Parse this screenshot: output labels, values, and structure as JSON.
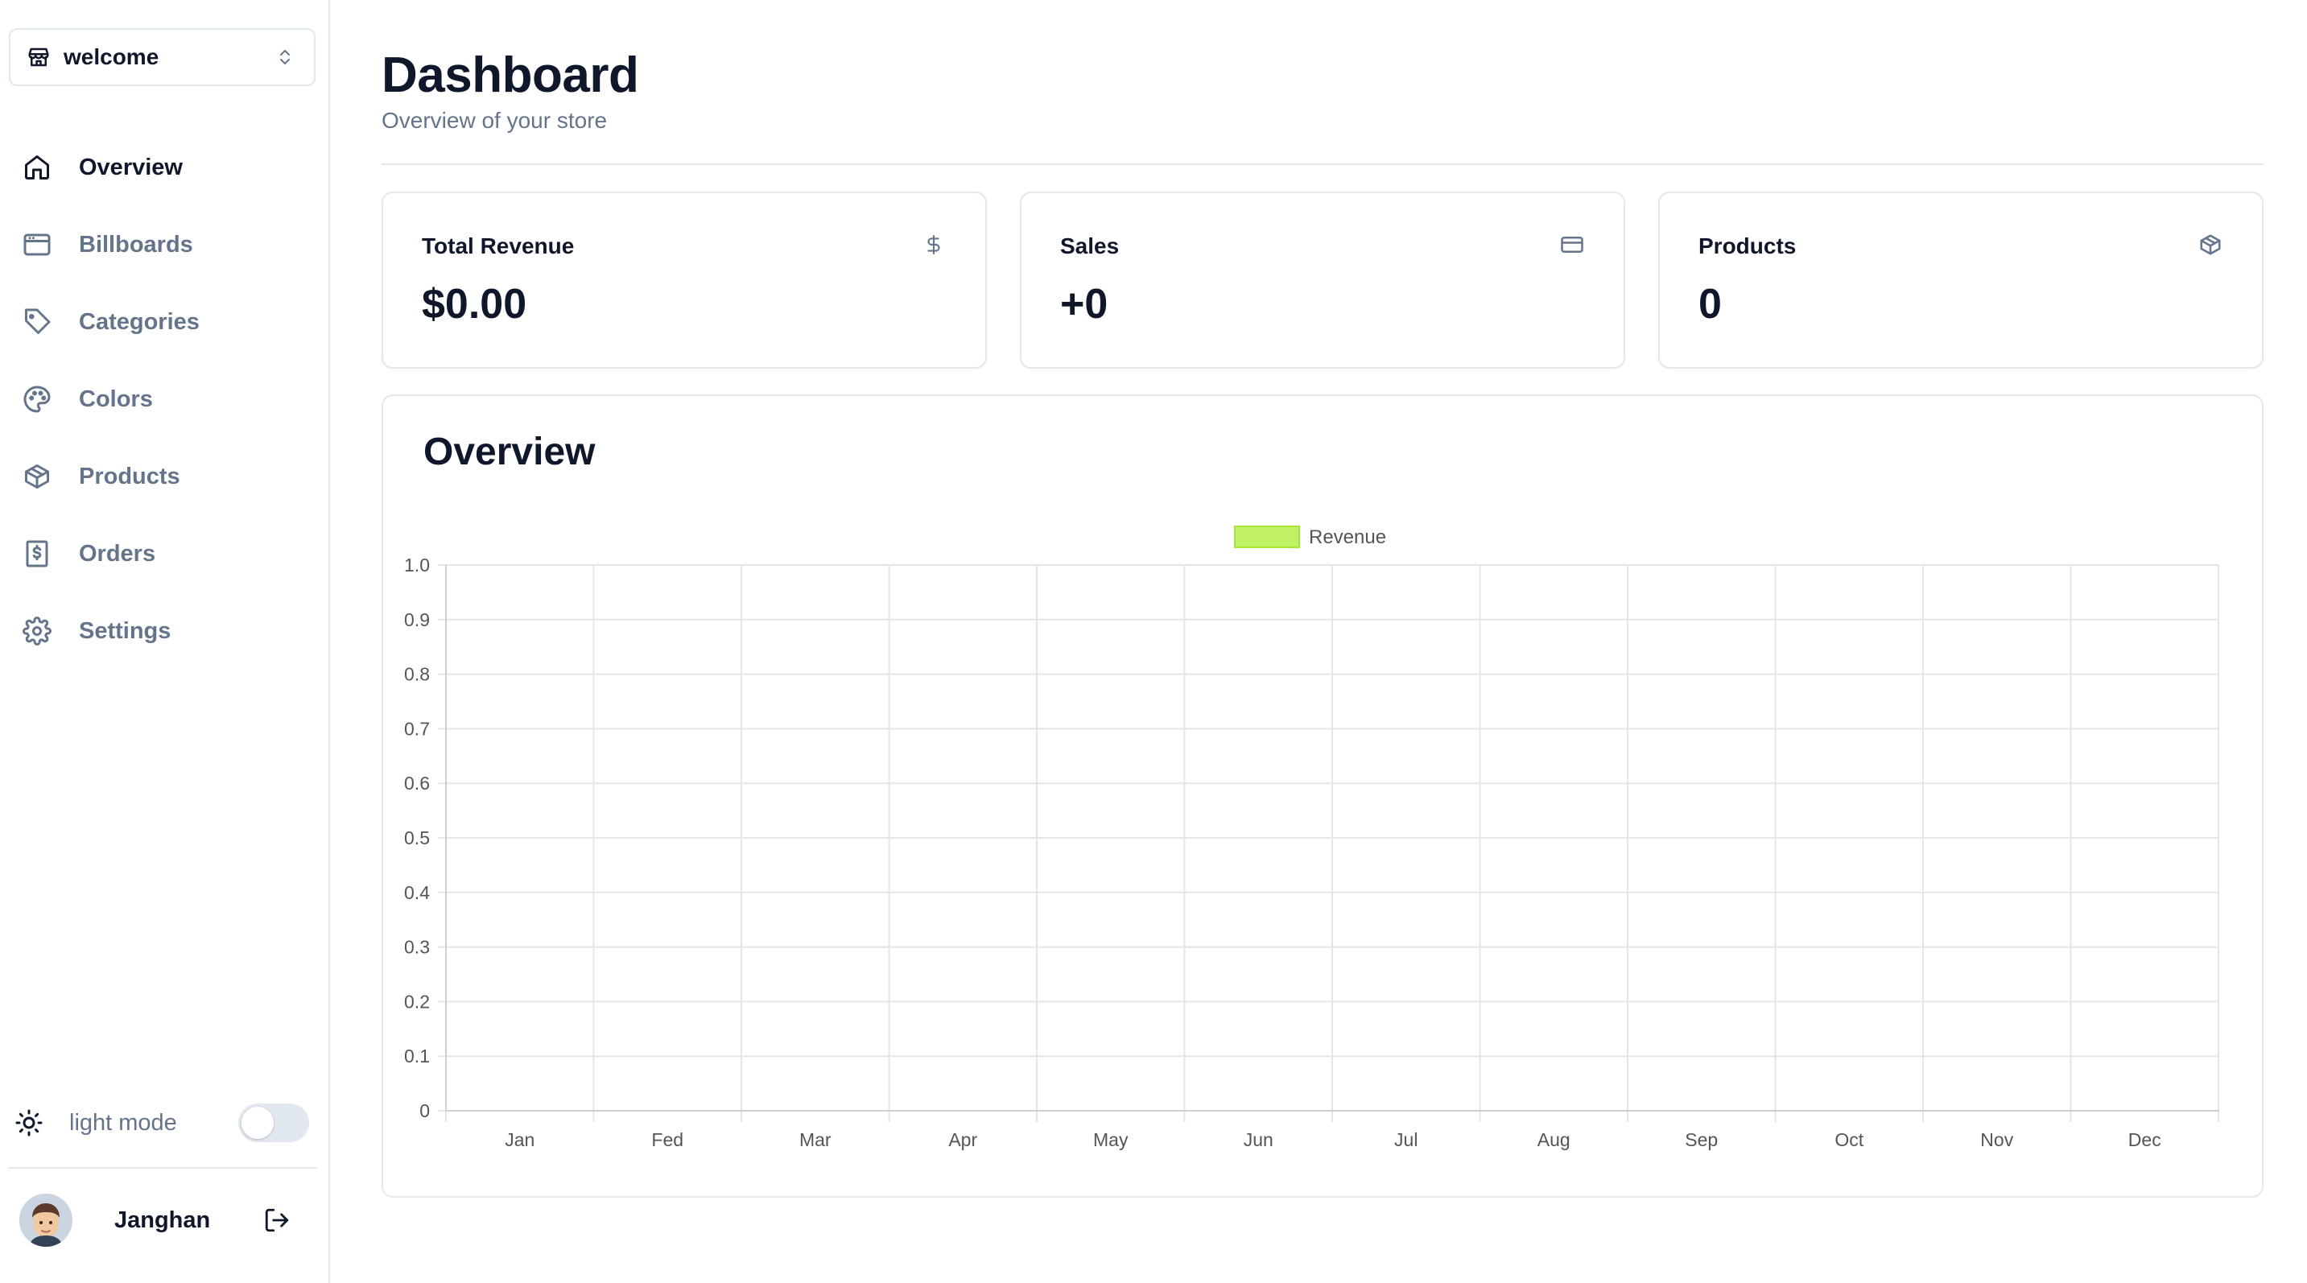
{
  "sidebar": {
    "store_switcher": {
      "name": "welcome",
      "store_icon": "store-icon",
      "chevron_icon": "chevrons-up-down-icon"
    },
    "nav": [
      {
        "label": "Overview",
        "icon": "home-icon",
        "active": true
      },
      {
        "label": "Billboards",
        "icon": "browser-window-icon",
        "active": false
      },
      {
        "label": "Categories",
        "icon": "tag-icon",
        "active": false
      },
      {
        "label": "Colors",
        "icon": "palette-icon",
        "active": false
      },
      {
        "label": "Products",
        "icon": "package-icon",
        "active": false
      },
      {
        "label": "Orders",
        "icon": "receipt-dollar-icon",
        "active": false
      },
      {
        "label": "Settings",
        "icon": "gear-icon",
        "active": false
      }
    ],
    "theme": {
      "label": "light mode",
      "icon": "sun-icon",
      "enabled": false
    },
    "user": {
      "name": "Janghan",
      "logout_icon": "logout-icon"
    }
  },
  "header": {
    "title": "Dashboard",
    "subtitle": "Overview of your store"
  },
  "cards": [
    {
      "label": "Total Revenue",
      "value": "$0.00",
      "icon": "dollar-sign-icon"
    },
    {
      "label": "Sales",
      "value": "+0",
      "icon": "credit-card-icon"
    },
    {
      "label": "Products",
      "value": "0",
      "icon": "package-icon"
    }
  ],
  "overview": {
    "title": "Overview"
  },
  "colors": {
    "accent_bar": "#bef264",
    "accent_bar_border": "#a3e635",
    "text_primary": "#0f172a",
    "text_muted": "#64748b",
    "border": "#e5e7eb"
  },
  "chart_data": {
    "type": "bar",
    "categories": [
      "Jan",
      "Fed",
      "Mar",
      "Apr",
      "May",
      "Jun",
      "Jul",
      "Aug",
      "Sep",
      "Oct",
      "Nov",
      "Dec"
    ],
    "series": [
      {
        "name": "Revenue",
        "values": [
          0,
          0,
          0,
          0,
          0,
          0,
          0,
          0,
          0,
          0,
          0,
          0
        ],
        "color": "#bef264"
      }
    ],
    "yticks": [
      "0",
      "0.1",
      "0.2",
      "0.3",
      "0.4",
      "0.5",
      "0.6",
      "0.7",
      "0.8",
      "0.9",
      "1.0"
    ],
    "ylim": [
      0,
      1
    ],
    "grid": true,
    "legend": "top-center"
  }
}
